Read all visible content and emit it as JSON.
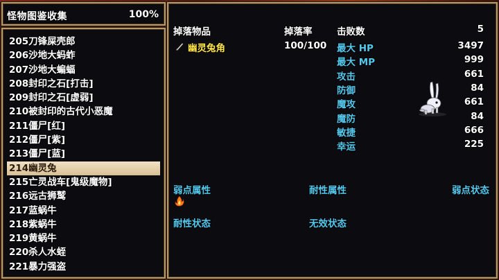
{
  "header": {
    "title": "怪物图鉴收集",
    "percent": "100%"
  },
  "list": {
    "items": [
      "205刀锋屎壳郎",
      "206沙地大蚂蚱",
      "207沙地大蝙蝠",
      "208封印之石[打击]",
      "209封印之石[虚弱]",
      "210被封印的古代小恶魔",
      "211僵尸[红]",
      "212僵尸[紫]",
      "213僵尸[蓝]",
      "214幽灵兔",
      "215亡灵战车[鬼级魔物]",
      "216远古狮鹫",
      "217蓝蜗牛",
      "218紫蜗牛",
      "219黄蜗牛",
      "220杀人水蛭",
      "221暴力强盗"
    ],
    "selected_index": 9
  },
  "detail": {
    "drop_item_header": "掉落物品",
    "drop_rate_header": "掉落率",
    "defeat_label": "击败数",
    "defeat_value": "5",
    "drop_item_name": "幽灵兔角",
    "drop_rate_value": "100/100",
    "stats": [
      {
        "label": "最大 HP",
        "value": "3497"
      },
      {
        "label": "最大 MP",
        "value": "999"
      },
      {
        "label": "攻击",
        "value": "661"
      },
      {
        "label": "防御",
        "value": "84"
      },
      {
        "label": "魔攻",
        "value": "661"
      },
      {
        "label": "魔防",
        "value": "84"
      },
      {
        "label": "敏捷",
        "value": "666"
      },
      {
        "label": "幸运",
        "value": "225"
      }
    ],
    "weak_attr_label": "弱点属性",
    "resist_attr_label": "耐性属性",
    "weak_state_label": "弱点状态",
    "resist_state_label": "耐性状态",
    "immune_state_label": "无效状态",
    "weak_attr_icons": [
      "fire-icon"
    ]
  }
}
